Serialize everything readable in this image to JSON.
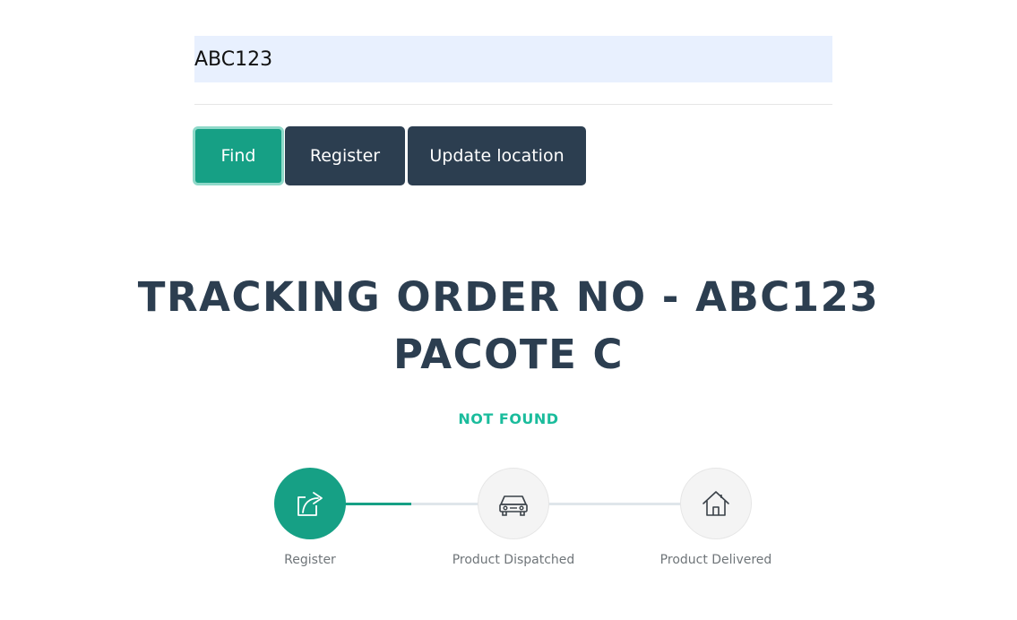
{
  "search": {
    "value": "ABC123"
  },
  "buttons": {
    "find": "Find",
    "register": "Register",
    "update_location": "Update location"
  },
  "heading": {
    "line1": "TRACKING ORDER NO - ABC123",
    "line2": "PACOTE C"
  },
  "status": {
    "text": "NOT FOUND",
    "color": "#1abc9c"
  },
  "progress": {
    "completed_steps": 1,
    "steps": [
      {
        "label": "Register",
        "icon": "share-icon",
        "state": "done"
      },
      {
        "label": "Product Dispatched",
        "icon": "car-icon",
        "state": "pending"
      },
      {
        "label": "Product Delivered",
        "icon": "home-icon",
        "state": "pending"
      }
    ]
  },
  "colors": {
    "accent": "#16a085",
    "dark": "#2c3e50",
    "input_bg": "#e8f0fe"
  }
}
